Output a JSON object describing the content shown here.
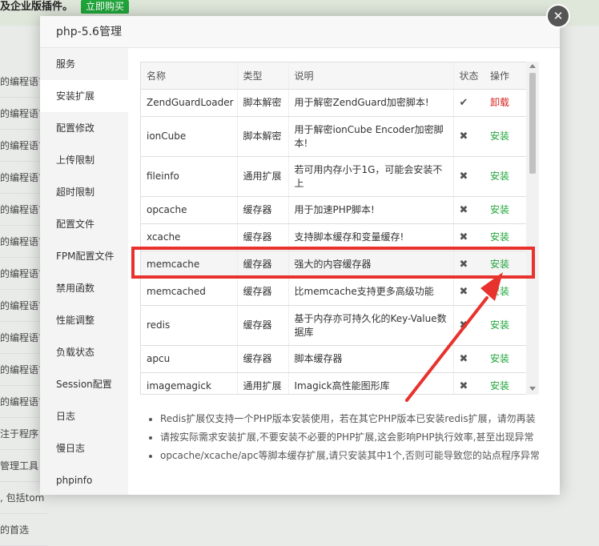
{
  "background": {
    "top_text": "及企业版插件。",
    "buy_button": "立即购买",
    "rows": [
      "的编程语言",
      "的编程语言",
      "的编程语言",
      "的编程语言",
      "的编程语言",
      "的编程语言",
      "的编程语言",
      "的编程语言",
      "的编程语言",
      "的编程语言",
      "的编程语言",
      "注于程序",
      "管理工具",
      ", 包括tom",
      "的首选"
    ]
  },
  "modal": {
    "title": "php-5.6管理",
    "close_glyph": "✕",
    "sidebar": [
      "服务",
      "安装扩展",
      "配置修改",
      "上传限制",
      "超时限制",
      "配置文件",
      "FPM配置文件",
      "禁用函数",
      "性能调整",
      "负载状态",
      "Session配置",
      "日志",
      "慢日志",
      "phpinfo"
    ],
    "active_index": 1,
    "table": {
      "headers": {
        "name": "名称",
        "type": "类型",
        "desc": "说明",
        "status": "状态",
        "action": "操作"
      },
      "rows": [
        {
          "name": "ZendGuardLoader",
          "type": "脚本解密",
          "desc": "用于解密ZendGuard加密脚本!",
          "status": "✔",
          "action": "卸载",
          "installed": true
        },
        {
          "name": "ionCube",
          "type": "脚本解密",
          "desc": "用于解密ionCube Encoder加密脚本!",
          "status": "✖",
          "action": "安装",
          "installed": false
        },
        {
          "name": "fileinfo",
          "type": "通用扩展",
          "desc": "若可用内存小于1G，可能会安装不上",
          "status": "✖",
          "action": "安装",
          "installed": false
        },
        {
          "name": "opcache",
          "type": "缓存器",
          "desc": "用于加速PHP脚本!",
          "status": "✖",
          "action": "安装",
          "installed": false
        },
        {
          "name": "xcache",
          "type": "缓存器",
          "desc": "支持脚本缓存和变量缓存!",
          "status": "✖",
          "action": "安装",
          "installed": false
        },
        {
          "name": "memcache",
          "type": "缓存器",
          "desc": "强大的内容缓存器",
          "status": "✖",
          "action": "安装",
          "installed": false
        },
        {
          "name": "memcached",
          "type": "缓存器",
          "desc": "比memcache支持更多高级功能",
          "status": "✖",
          "action": "安装",
          "installed": false
        },
        {
          "name": "redis",
          "type": "缓存器",
          "desc": "基于内存亦可持久化的Key-Value数据库",
          "status": "✖",
          "action": "安装",
          "installed": false
        },
        {
          "name": "apcu",
          "type": "缓存器",
          "desc": "脚本缓存器",
          "status": "✖",
          "action": "安装",
          "installed": false
        },
        {
          "name": "imagemagick",
          "type": "通用扩展",
          "desc": "Imagick高性能图形库",
          "status": "✖",
          "action": "安装",
          "installed": false
        }
      ],
      "highlight_index": 5
    },
    "notes": [
      "Redis扩展仅支持一个PHP版本安装使用，若在其它PHP版本已安装redis扩展，请勿再装",
      "请按实际需求安装扩展,不要安装不必要的PHP扩展,这会影响PHP执行效率,甚至出现异常",
      "opcache/xcache/apc等脚本缓存扩展,请只安装其中1个,否则可能导致您的站点程序异常"
    ]
  },
  "colors": {
    "accent_green": "#20a53a",
    "uninstall_red": "#d9221c",
    "annotation_red": "#e8322d"
  }
}
